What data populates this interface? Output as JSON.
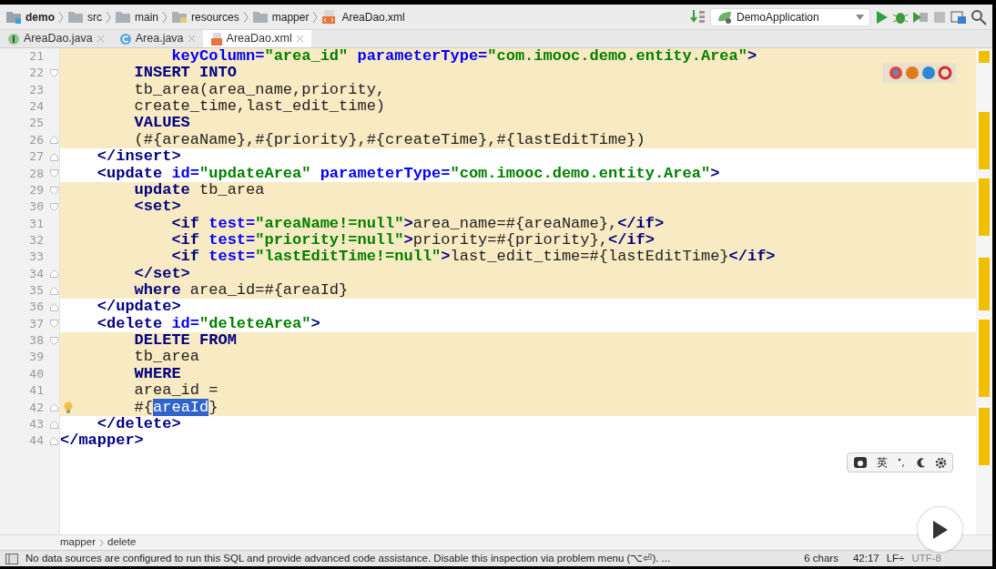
{
  "breadcrumbs": [
    {
      "label": "demo",
      "kind": "project"
    },
    {
      "label": "src",
      "kind": "folder"
    },
    {
      "label": "main",
      "kind": "folder"
    },
    {
      "label": "resources",
      "kind": "resources"
    },
    {
      "label": "mapper",
      "kind": "folder"
    },
    {
      "label": "AreaDao.xml",
      "kind": "xml"
    }
  ],
  "run_config": {
    "label": "DemoApplication"
  },
  "tabs": [
    {
      "label": "AreaDao.java",
      "kind": "interface",
      "selected": false
    },
    {
      "label": "Area.java",
      "kind": "class",
      "selected": false
    },
    {
      "label": "AreaDao.xml",
      "kind": "xml",
      "selected": true
    }
  ],
  "lines": [
    {
      "number": "21",
      "highlight": true,
      "fold_start": false,
      "fold_end": false,
      "bulb": false,
      "tokens": [
        {
          "kind": "attr",
          "text": "            keyColumn="
        },
        {
          "kind": "str",
          "text": "\"area_id\""
        },
        {
          "kind": "attr",
          "text": " parameterType="
        },
        {
          "kind": "str",
          "text": "\"com.imooc.demo.entity.Area\""
        },
        {
          "kind": "tag",
          "text": ">"
        }
      ]
    },
    {
      "number": "22",
      "highlight": true,
      "fold_start": true,
      "fold_end": false,
      "bulb": false,
      "tokens": [
        {
          "kind": "kw",
          "text": "        INSERT INTO"
        }
      ]
    },
    {
      "number": "23",
      "highlight": true,
      "fold_start": false,
      "fold_end": false,
      "bulb": false,
      "tokens": [
        {
          "kind": "text",
          "text": "        tb_area(area_name,priority,"
        }
      ]
    },
    {
      "number": "24",
      "highlight": true,
      "fold_start": false,
      "fold_end": false,
      "bulb": false,
      "tokens": [
        {
          "kind": "text",
          "text": "        create_time,last_edit_time)"
        }
      ]
    },
    {
      "number": "25",
      "highlight": true,
      "fold_start": false,
      "fold_end": false,
      "bulb": false,
      "tokens": [
        {
          "kind": "kw",
          "text": "        VALUES"
        }
      ]
    },
    {
      "number": "26",
      "highlight": true,
      "fold_start": false,
      "fold_end": true,
      "bulb": false,
      "tokens": [
        {
          "kind": "text",
          "text": "        (#{areaName},#{priority},#{createTime},#{lastEditTime})"
        }
      ]
    },
    {
      "number": "27",
      "highlight": false,
      "fold_start": false,
      "fold_end": true,
      "bulb": false,
      "tokens": [
        {
          "kind": "tag",
          "text": "    </insert>"
        }
      ]
    },
    {
      "number": "28",
      "highlight": false,
      "fold_start": true,
      "fold_end": false,
      "bulb": false,
      "tokens": [
        {
          "kind": "tag",
          "text": "    <update"
        },
        {
          "kind": "attr",
          "text": " id="
        },
        {
          "kind": "str",
          "text": "\"updateArea\""
        },
        {
          "kind": "attr",
          "text": " parameterType="
        },
        {
          "kind": "str",
          "text": "\"com.imooc.demo.entity.Area\""
        },
        {
          "kind": "tag",
          "text": ">"
        }
      ]
    },
    {
      "number": "29",
      "highlight": true,
      "fold_start": true,
      "fold_end": false,
      "bulb": false,
      "tokens": [
        {
          "kind": "kw",
          "text": "        update"
        },
        {
          "kind": "text",
          "text": " tb_area"
        }
      ]
    },
    {
      "number": "30",
      "highlight": true,
      "fold_start": true,
      "fold_end": false,
      "bulb": false,
      "tokens": [
        {
          "kind": "tag",
          "text": "        <set>"
        }
      ]
    },
    {
      "number": "31",
      "highlight": true,
      "fold_start": false,
      "fold_end": false,
      "bulb": false,
      "tokens": [
        {
          "kind": "tag",
          "text": "            <if"
        },
        {
          "kind": "attr",
          "text": " test="
        },
        {
          "kind": "str",
          "text": "\"areaName!=null\""
        },
        {
          "kind": "tag",
          "text": ">"
        },
        {
          "kind": "text",
          "text": "area_name=#{areaName},"
        },
        {
          "kind": "tag",
          "text": "</if>"
        }
      ]
    },
    {
      "number": "32",
      "highlight": true,
      "fold_start": false,
      "fold_end": false,
      "bulb": false,
      "tokens": [
        {
          "kind": "tag",
          "text": "            <if"
        },
        {
          "kind": "attr",
          "text": " test="
        },
        {
          "kind": "str",
          "text": "\"priority!=null\""
        },
        {
          "kind": "tag",
          "text": ">"
        },
        {
          "kind": "text",
          "text": "priority=#{priority},"
        },
        {
          "kind": "tag",
          "text": "</if>"
        }
      ]
    },
    {
      "number": "33",
      "highlight": true,
      "fold_start": false,
      "fold_end": false,
      "bulb": false,
      "tokens": [
        {
          "kind": "tag",
          "text": "            <if"
        },
        {
          "kind": "attr",
          "text": " test="
        },
        {
          "kind": "str",
          "text": "\"lastEditTime!=null\""
        },
        {
          "kind": "tag",
          "text": ">"
        },
        {
          "kind": "text",
          "text": "last_edit_time=#{lastEditTime}"
        },
        {
          "kind": "tag",
          "text": "</if>"
        }
      ]
    },
    {
      "number": "34",
      "highlight": true,
      "fold_start": false,
      "fold_end": true,
      "bulb": false,
      "tokens": [
        {
          "kind": "tag",
          "text": "        </set>"
        }
      ]
    },
    {
      "number": "35",
      "highlight": true,
      "fold_start": false,
      "fold_end": true,
      "bulb": false,
      "tokens": [
        {
          "kind": "kw",
          "text": "        where"
        },
        {
          "kind": "text",
          "text": " area_id=#{areaId}"
        }
      ]
    },
    {
      "number": "36",
      "highlight": false,
      "fold_start": false,
      "fold_end": true,
      "bulb": false,
      "tokens": [
        {
          "kind": "tag",
          "text": "    </update>"
        }
      ]
    },
    {
      "number": "37",
      "highlight": false,
      "fold_start": true,
      "fold_end": false,
      "bulb": false,
      "tokens": [
        {
          "kind": "tag",
          "text": "    <delete"
        },
        {
          "kind": "attr",
          "text": " id="
        },
        {
          "kind": "str",
          "text": "\"deleteArea\""
        },
        {
          "kind": "tag",
          "text": ">"
        }
      ]
    },
    {
      "number": "38",
      "highlight": true,
      "fold_start": true,
      "fold_end": false,
      "bulb": false,
      "tokens": [
        {
          "kind": "kw",
          "text": "        DELETE FROM"
        }
      ]
    },
    {
      "number": "39",
      "highlight": true,
      "fold_start": false,
      "fold_end": false,
      "bulb": false,
      "tokens": [
        {
          "kind": "text",
          "text": "        tb_area"
        }
      ]
    },
    {
      "number": "40",
      "highlight": true,
      "fold_start": false,
      "fold_end": false,
      "bulb": false,
      "tokens": [
        {
          "kind": "kw",
          "text": "        WHERE"
        }
      ]
    },
    {
      "number": "41",
      "highlight": true,
      "fold_start": false,
      "fold_end": false,
      "bulb": false,
      "tokens": [
        {
          "kind": "text",
          "text": "        area_id ="
        }
      ]
    },
    {
      "number": "42",
      "highlight": true,
      "fold_start": false,
      "fold_end": true,
      "bulb": true,
      "tokens": [
        {
          "kind": "text",
          "text": "        #{"
        },
        {
          "kind": "sel",
          "text": "areaId"
        },
        {
          "kind": "text",
          "text": "}"
        }
      ]
    },
    {
      "number": "43",
      "highlight": false,
      "fold_start": false,
      "fold_end": true,
      "bulb": false,
      "tokens": [
        {
          "kind": "tag",
          "text": "    </delete>"
        }
      ]
    },
    {
      "number": "44",
      "highlight": false,
      "fold_start": false,
      "fold_end": true,
      "bulb": false,
      "tokens": [
        {
          "kind": "tag",
          "text": "</mapper>"
        }
      ]
    }
  ],
  "ime_toolbar": {
    "language": "英"
  },
  "footer_path": [
    "mapper",
    "delete"
  ],
  "status_bar": {
    "message": "No data sources are configured to run this SQL and provide advanced code assistance. Disable this inspection via problem menu (⌥⏎). ...",
    "selection": "6 chars",
    "position": "42:17",
    "line_separator": "LF÷",
    "encoding": "UTF-8"
  }
}
